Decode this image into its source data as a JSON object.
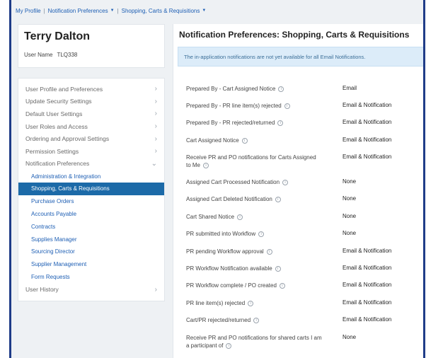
{
  "breadcrumb": {
    "items": [
      "My Profile",
      "Notification Preferences",
      "Shopping, Carts & Requisitions"
    ]
  },
  "user": {
    "name": "Terry Dalton",
    "username_label": "User Name",
    "username_value": "TLQ338"
  },
  "menu": {
    "items": [
      "User Profile and Preferences",
      "Update Security Settings",
      "Default User Settings",
      "User Roles and Access",
      "Ordering and Approval Settings",
      "Permission Settings",
      "Notification Preferences"
    ],
    "subitems": [
      "Administration & Integration",
      "Shopping, Carts & Requisitions",
      "Purchase Orders",
      "Accounts Payable",
      "Contracts",
      "Supplies Manager",
      "Sourcing Director",
      "Supplier Management",
      "Form Requests"
    ],
    "footer_item": "User History"
  },
  "main": {
    "title": "Notification Preferences:  Shopping, Carts & Requisitions",
    "banner": "The in-application notifications are not yet available for all Email Notifications.",
    "rows": [
      {
        "label": "Prepared By - Cart Assigned Notice",
        "value": "Email"
      },
      {
        "label": "Prepared By - PR line item(s) rejected",
        "value": "Email & Notification"
      },
      {
        "label": "Prepared By - PR rejected/returned",
        "value": "Email & Notification"
      },
      {
        "label": "Cart Assigned Notice",
        "value": "Email & Notification"
      },
      {
        "label": "Receive PR and PO notifications for Carts Assigned to Me",
        "value": "Email & Notification"
      },
      {
        "label": "Assigned Cart Processed Notification",
        "value": "None"
      },
      {
        "label": "Assigned Cart Deleted Notification",
        "value": "None"
      },
      {
        "label": "Cart Shared Notice",
        "value": "None"
      },
      {
        "label": "PR submitted into Workflow",
        "value": "None"
      },
      {
        "label": "PR pending Workflow approval",
        "value": "Email & Notification"
      },
      {
        "label": "PR Workflow Notification available",
        "value": "Email & Notification"
      },
      {
        "label": "PR Workflow complete / PO created",
        "value": "Email & Notification"
      },
      {
        "label": "PR line item(s) rejected",
        "value": "Email & Notification"
      },
      {
        "label": "Cart/PR rejected/returned",
        "value": "Email & Notification"
      },
      {
        "label": "Receive PR and PO notifications for shared carts I am a participant of",
        "value": "None"
      }
    ]
  }
}
